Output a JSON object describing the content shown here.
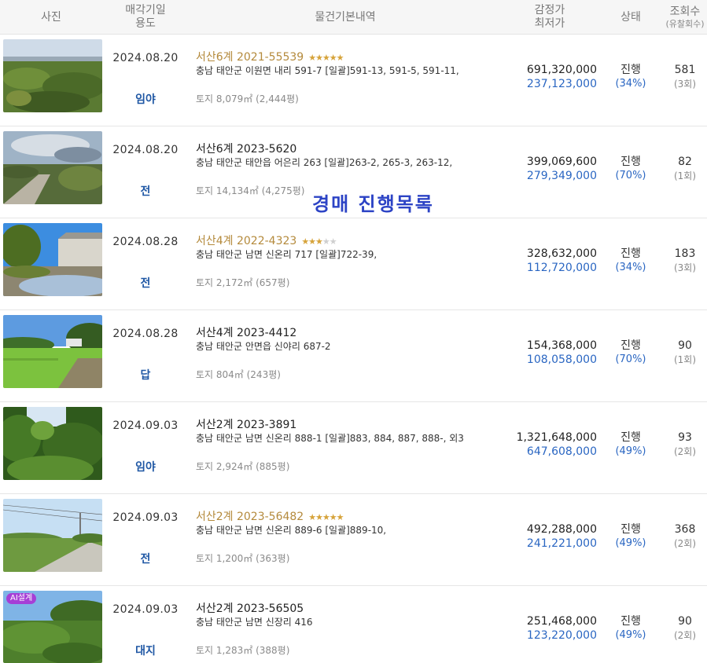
{
  "header": {
    "photo": "사진",
    "date_line1": "매각기일",
    "date_line2": "용도",
    "info": "물건기본내역",
    "price_line1": "감정가",
    "price_line2": "최저가",
    "status": "상태",
    "views_line1": "조회수",
    "views_line2": "(유찰회수)"
  },
  "watermark": "경매  진행목록",
  "rows": [
    {
      "date": "2024.08.20",
      "usage": "임야",
      "case": "서산6계 2021-55539",
      "stars": "★★★★★",
      "stars_off": "",
      "addr": "충남 태안군 이원면 내리 591-7  [일괄]591-13, 591-5, 591-11,",
      "land": "토지 8,079㎡ (2,444평)",
      "appraisal": "691,320,000",
      "minimum": "237,123,000",
      "status": "진행",
      "pct": "(34%)",
      "views": "581",
      "fails": "(3회)"
    },
    {
      "date": "2024.08.20",
      "usage": "전",
      "case": "서산6계 2023-5620",
      "stars": "",
      "stars_off": "",
      "addr": "충남 태안군 태안읍 어은리 263  [일괄]263-2, 265-3, 263-12,",
      "land": "토지 14,134㎡ (4,275평)",
      "appraisal": "399,069,600",
      "minimum": "279,349,000",
      "status": "진행",
      "pct": "(70%)",
      "views": "82",
      "fails": "(1회)"
    },
    {
      "date": "2024.08.28",
      "usage": "전",
      "case": "서산4계 2022-4323",
      "stars": "★★★",
      "stars_off": "★★",
      "addr": "충남 태안군 남면 신온리 717  [일괄]722-39,",
      "land": "토지 2,172㎡ (657평)",
      "appraisal": "328,632,000",
      "minimum": "112,720,000",
      "status": "진행",
      "pct": "(34%)",
      "views": "183",
      "fails": "(3회)"
    },
    {
      "date": "2024.08.28",
      "usage": "답",
      "case": "서산4계 2023-4412",
      "stars": "",
      "stars_off": "",
      "addr": "충남 태안군 안면읍 신야리 687-2",
      "land": "토지 804㎡ (243평)",
      "appraisal": "154,368,000",
      "minimum": "108,058,000",
      "status": "진행",
      "pct": "(70%)",
      "views": "90",
      "fails": "(1회)"
    },
    {
      "date": "2024.09.03",
      "usage": "임야",
      "case": "서산2계 2023-3891",
      "stars": "",
      "stars_off": "",
      "addr": "충남 태안군 남면 신온리 888-1  [일괄]883, 884, 887, 888-, 외3",
      "land": "토지 2,924㎡ (885평)",
      "appraisal": "1,321,648,000",
      "minimum": "647,608,000",
      "status": "진행",
      "pct": "(49%)",
      "views": "93",
      "fails": "(2회)"
    },
    {
      "date": "2024.09.03",
      "usage": "전",
      "case": "서산2계 2023-56482",
      "stars": "★★★★★",
      "stars_off": "",
      "addr": "충남 태안군 남면 신온리 889-6  [일괄]889-10,",
      "land": "토지 1,200㎡ (363평)",
      "appraisal": "492,288,000",
      "minimum": "241,221,000",
      "status": "진행",
      "pct": "(49%)",
      "views": "368",
      "fails": "(2회)"
    },
    {
      "date": "2024.09.03",
      "usage": "대지",
      "case": "서산2계 2023-56505",
      "stars": "",
      "stars_off": "",
      "addr": "충남 태안군 남면 신장리 416",
      "land": "토지 1,283㎡ (388평)",
      "appraisal": "251,468,000",
      "minimum": "123,220,000",
      "status": "진행",
      "pct": "(49%)",
      "views": "90",
      "fails": "(2회)",
      "badge": "AI설계"
    }
  ]
}
